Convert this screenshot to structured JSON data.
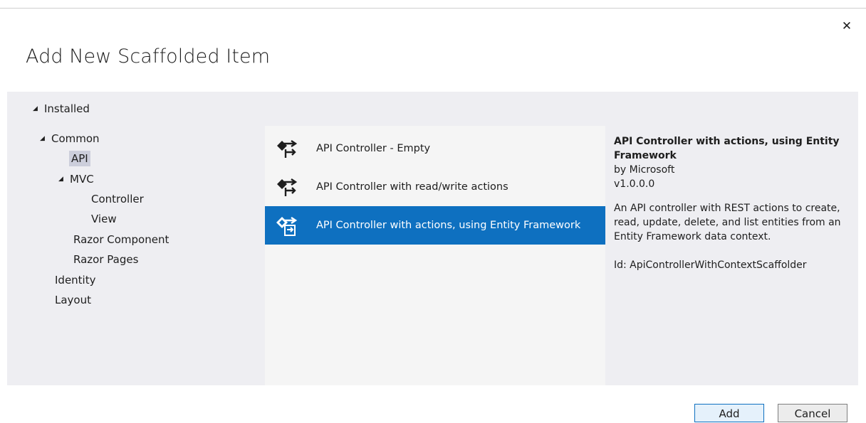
{
  "dialog": {
    "title": "Add New Scaffolded Item",
    "close_glyph": "✕"
  },
  "tree": {
    "installed": "Installed",
    "common": "Common",
    "api": "API",
    "mvc": "MVC",
    "controller": "Controller",
    "view": "View",
    "razor_component": "Razor Component",
    "razor_pages": "Razor Pages",
    "identity": "Identity",
    "layout": "Layout",
    "expander_glyph": "◢"
  },
  "templates": [
    {
      "label": "API Controller - Empty",
      "icon": "api-controller-icon",
      "selected": false
    },
    {
      "label": "API Controller with read/write actions",
      "icon": "api-controller-icon",
      "selected": false
    },
    {
      "label": "API Controller with actions, using Entity Framework",
      "icon": "api-controller-ef-icon",
      "selected": true
    }
  ],
  "details": {
    "title": "API Controller with actions, using Entity Framework",
    "author": "by Microsoft",
    "version": "v1.0.0.0",
    "description": "An API controller with REST actions to create, read, update, delete, and list entities from an Entity Framework data context.",
    "id": "Id: ApiControllerWithContextScaffolder"
  },
  "buttons": {
    "add": "Add",
    "cancel": "Cancel"
  },
  "colors": {
    "selection": "#0e70c0",
    "panel": "#eeeef2",
    "list": "#f5f5f5"
  }
}
